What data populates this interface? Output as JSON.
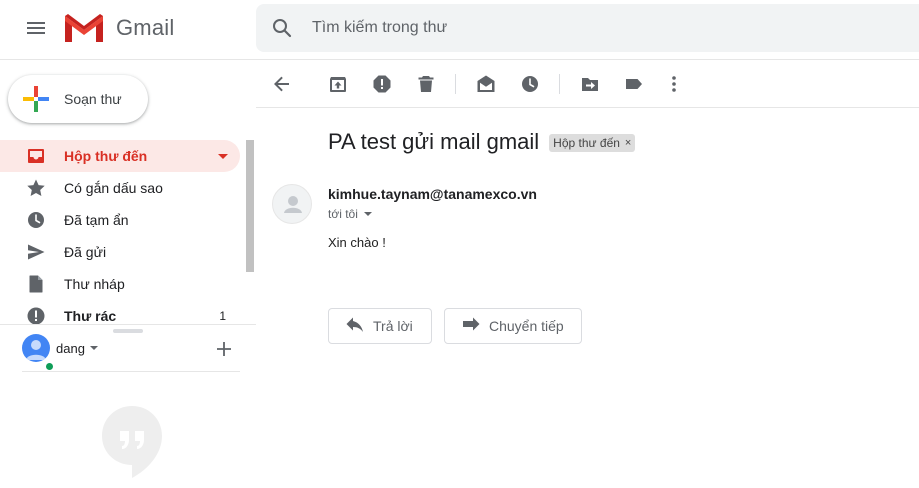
{
  "header": {
    "app_name": "Gmail",
    "search_placeholder": "Tìm kiếm trong thư"
  },
  "compose": {
    "label": "Soạn thư"
  },
  "sidebar": {
    "items": [
      {
        "label": "Hộp thư đến",
        "icon": "inbox-icon",
        "active": true
      },
      {
        "label": "Có gắn dấu sao",
        "icon": "star-icon"
      },
      {
        "label": "Đã tạm ẩn",
        "icon": "clock-icon"
      },
      {
        "label": "Đã gửi",
        "icon": "send-icon"
      },
      {
        "label": "Thư nháp",
        "icon": "draft-icon"
      },
      {
        "label": "Thư rác",
        "icon": "spam-icon",
        "count": "1"
      }
    ]
  },
  "hangouts": {
    "user_name": "dang"
  },
  "toolbar": {
    "icons": [
      "back-arrow-icon",
      "archive-icon",
      "report-spam-icon",
      "delete-icon",
      "mark-unread-icon",
      "snooze-icon",
      "move-to-icon",
      "label-icon",
      "more-vert-icon"
    ]
  },
  "message": {
    "subject": "PA test gửi mail gmail",
    "label_chip": "Hộp thư đến",
    "label_chip_close": "×",
    "sender": "kimhue.taynam@tanamexco.vn",
    "to": "tới tôi",
    "body": "Xin chào !"
  },
  "actions": {
    "reply": "Trả lời",
    "forward": "Chuyển tiếp"
  },
  "colors": {
    "accent_red": "#d93025",
    "active_bg": "#fce8e6",
    "search_bg": "#f1f3f4",
    "online_green": "#0f9d58"
  }
}
